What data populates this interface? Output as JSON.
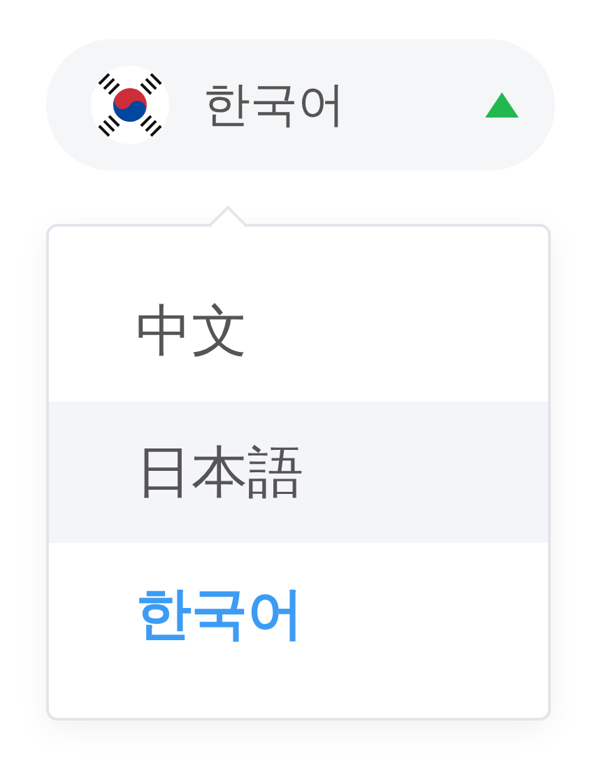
{
  "trigger": {
    "label": "한국어",
    "expanded": true
  },
  "options": [
    {
      "label": "中文",
      "hovered": false,
      "selected": false
    },
    {
      "label": "日本語",
      "hovered": true,
      "selected": false
    },
    {
      "label": "한국어",
      "hovered": false,
      "selected": true
    }
  ]
}
